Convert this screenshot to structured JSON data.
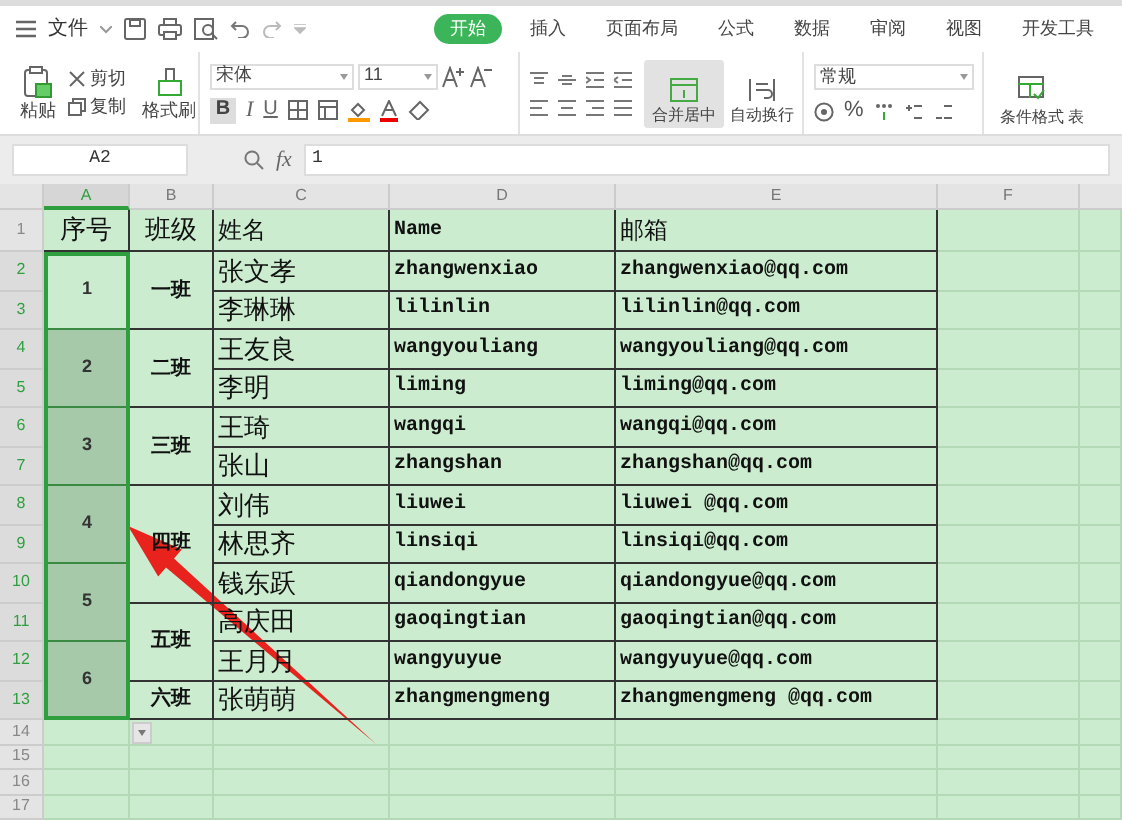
{
  "quick_access": {
    "file_menu": "文件"
  },
  "ribbon_tabs": [
    {
      "label": "开始",
      "selected": true
    },
    {
      "label": "插入",
      "selected": false
    },
    {
      "label": "页面布局",
      "selected": false
    },
    {
      "label": "公式",
      "selected": false
    },
    {
      "label": "数据",
      "selected": false
    },
    {
      "label": "审阅",
      "selected": false
    },
    {
      "label": "视图",
      "selected": false
    },
    {
      "label": "开发工具",
      "selected": false
    }
  ],
  "ribbon": {
    "paste": "粘贴",
    "cut": "剪切",
    "copy": "复制",
    "format_painter": "格式刷",
    "font": "宋体",
    "font_size": "11",
    "bold": "B",
    "italic": "I",
    "underline": "U",
    "merge_center": "合并居中",
    "wrap_text": "自动换行",
    "number_format": "常规",
    "percent": "%",
    "conditional_format": "条件格式",
    "next_group": "表"
  },
  "formula_bar": {
    "cell_ref": "A2",
    "fx": "fx",
    "value": "1"
  },
  "sheet": {
    "columns": [
      {
        "label": "A",
        "selected": true
      },
      {
        "label": "B",
        "selected": false
      },
      {
        "label": "C",
        "selected": false
      },
      {
        "label": "D",
        "selected": false
      },
      {
        "label": "E",
        "selected": false
      },
      {
        "label": "F",
        "selected": false
      }
    ],
    "row_numbers": [
      {
        "label": "1",
        "selected": false
      },
      {
        "label": "2",
        "selected": true
      },
      {
        "label": "3",
        "selected": true
      },
      {
        "label": "4",
        "selected": true
      },
      {
        "label": "5",
        "selected": true
      },
      {
        "label": "6",
        "selected": true
      },
      {
        "label": "7",
        "selected": true
      },
      {
        "label": "8",
        "selected": true
      },
      {
        "label": "9",
        "selected": true
      },
      {
        "label": "10",
        "selected": true
      },
      {
        "label": "11",
        "selected": true
      },
      {
        "label": "12",
        "selected": true
      },
      {
        "label": "13",
        "selected": true
      },
      {
        "label": "14",
        "selected": false
      },
      {
        "label": "15",
        "selected": false
      },
      {
        "label": "16",
        "selected": false
      },
      {
        "label": "17",
        "selected": false
      }
    ],
    "headers": [
      "序号",
      "班级",
      "姓名",
      "Name",
      "邮箱"
    ],
    "serials": [
      {
        "number": "1",
        "active": true
      },
      {
        "number": "2",
        "active": false
      },
      {
        "number": "3",
        "active": false
      },
      {
        "number": "4",
        "active": false
      },
      {
        "number": "5",
        "active": false
      },
      {
        "number": "6",
        "active": false
      }
    ],
    "classes": [
      {
        "name": "一班",
        "members": [
          {
            "name": "张文孝",
            "pinyin": "zhangwenxiao",
            "email": "zhangwenxiao@qq.com"
          },
          {
            "name": "李琳琳",
            "pinyin": "lilinlin",
            "email": "lilinlin@qq.com"
          }
        ]
      },
      {
        "name": "二班",
        "members": [
          {
            "name": "王友良",
            "pinyin": "wangyouliang",
            "email": "wangyouliang@qq.com"
          },
          {
            "name": "李明",
            "pinyin": "liming",
            "email": "liming@qq.com"
          }
        ]
      },
      {
        "name": "三班",
        "members": [
          {
            "name": "王琦",
            "pinyin": "wangqi",
            "email": "wangqi@qq.com"
          },
          {
            "name": "张山",
            "pinyin": "zhangshan",
            "email": "zhangshan@qq.com"
          }
        ]
      },
      {
        "name": "四班",
        "members": [
          {
            "name": "刘伟",
            "pinyin": "liuwei",
            "email": "liuwei @qq.com"
          },
          {
            "name": "林思齐",
            "pinyin": "linsiqi",
            "email": "linsiqi@qq.com"
          },
          {
            "name": "钱东跃",
            "pinyin": "qiandongyue",
            "email": "qiandongyue@qq.com"
          }
        ]
      },
      {
        "name": "五班",
        "members": [
          {
            "name": "高庆田",
            "pinyin": "gaoqingtian",
            "email": "gaoqingtian@qq.com"
          },
          {
            "name": "王月月",
            "pinyin": "wangyuyue",
            "email": "wangyuyue@qq.com"
          }
        ]
      },
      {
        "name": "六班",
        "members": [
          {
            "name": "张萌萌",
            "pinyin": "zhangmengmeng",
            "email": "zhangmengmeng @qq.com"
          }
        ]
      }
    ]
  }
}
